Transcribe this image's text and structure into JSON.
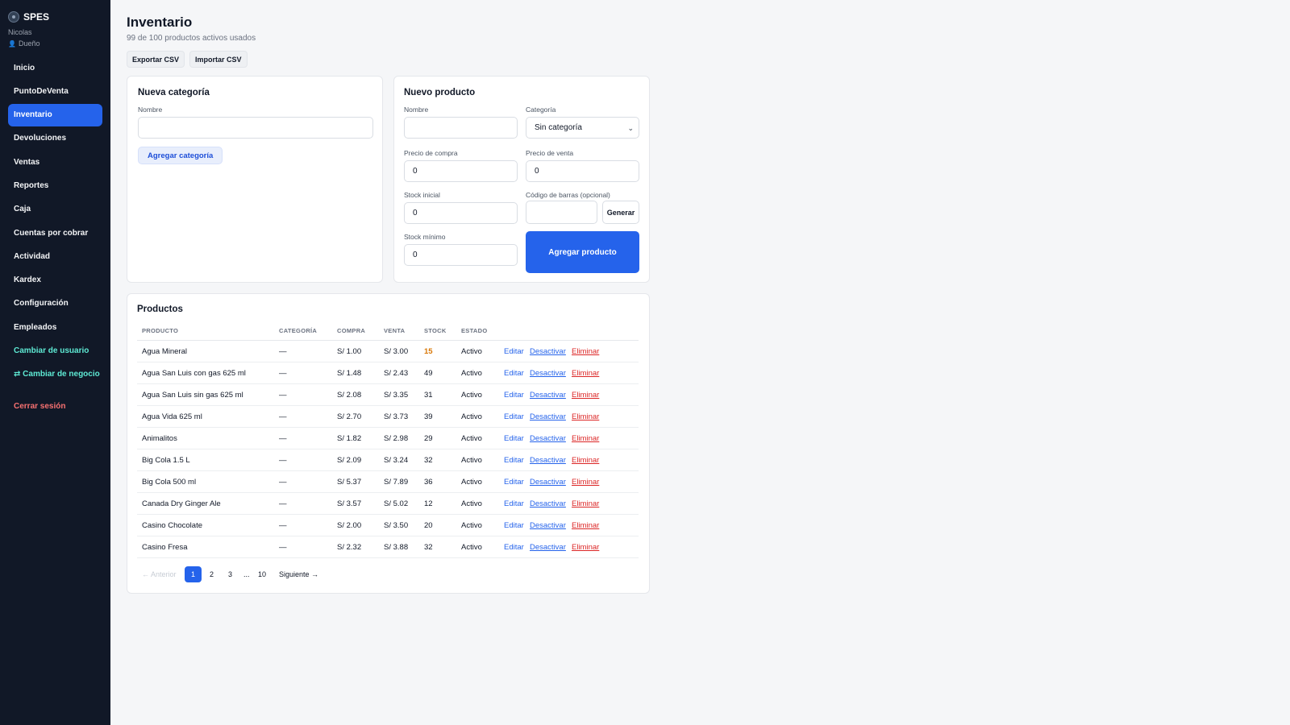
{
  "sidebar": {
    "brand": "SPES",
    "user": "Nicolas",
    "role": "Dueño",
    "items": [
      {
        "label": "Inicio"
      },
      {
        "label": "PuntoDeVenta"
      },
      {
        "label": "Inventario"
      },
      {
        "label": "Devoluciones"
      },
      {
        "label": "Ventas"
      },
      {
        "label": "Reportes"
      },
      {
        "label": "Caja"
      },
      {
        "label": "Cuentas por cobrar"
      },
      {
        "label": "Actividad"
      },
      {
        "label": "Kardex"
      },
      {
        "label": "Configuración"
      },
      {
        "label": "Empleados"
      },
      {
        "label": "Cambiar de usuario"
      },
      {
        "label": "⇄ Cambiar de negocio"
      }
    ],
    "logout": "Cerrar sesión"
  },
  "header": {
    "title": "Inventario",
    "subtitle": "99 de 100 productos activos usados",
    "export_label": "Exportar CSV",
    "import_label": "Importar CSV"
  },
  "category_form": {
    "title": "Nueva categoría",
    "name_label": "Nombre",
    "name_value": "",
    "submit_label": "Agregar categoría"
  },
  "product_form": {
    "title": "Nuevo producto",
    "name_label": "Nombre",
    "name_value": "",
    "category_label": "Categoría",
    "category_value": "Sin categoría",
    "buy_price_label": "Precio de compra",
    "buy_price_value": "0",
    "sell_price_label": "Precio de venta",
    "sell_price_value": "0",
    "stock_label": "Stock inicial",
    "stock_value": "0",
    "barcode_label": "Código de barras (opcional)",
    "barcode_value": "",
    "generate_label": "Generar",
    "min_stock_label": "Stock mínimo",
    "min_stock_value": "0",
    "submit_label": "Agregar producto"
  },
  "products": {
    "title": "Productos",
    "columns": [
      "PRODUCTO",
      "CATEGORÍA",
      "COMPRA",
      "VENTA",
      "STOCK",
      "ESTADO"
    ],
    "rows": [
      {
        "name": "Agua Mineral",
        "category": "—",
        "buy": "S/ 1.00",
        "sell": "S/ 3.00",
        "stock": "15",
        "status": "Activo"
      },
      {
        "name": "Agua San Luis con gas 625 ml",
        "category": "—",
        "buy": "S/ 1.48",
        "sell": "S/ 2.43",
        "stock": "49",
        "status": "Activo"
      },
      {
        "name": "Agua San Luis sin gas 625 ml",
        "category": "—",
        "buy": "S/ 2.08",
        "sell": "S/ 3.35",
        "stock": "31",
        "status": "Activo"
      },
      {
        "name": "Agua Vida 625 ml",
        "category": "—",
        "buy": "S/ 2.70",
        "sell": "S/ 3.73",
        "stock": "39",
        "status": "Activo"
      },
      {
        "name": "Animalitos",
        "category": "—",
        "buy": "S/ 1.82",
        "sell": "S/ 2.98",
        "stock": "29",
        "status": "Activo"
      },
      {
        "name": "Big Cola 1.5 L",
        "category": "—",
        "buy": "S/ 2.09",
        "sell": "S/ 3.24",
        "stock": "32",
        "status": "Activo"
      },
      {
        "name": "Big Cola 500 ml",
        "category": "—",
        "buy": "S/ 5.37",
        "sell": "S/ 7.89",
        "stock": "36",
        "status": "Activo"
      },
      {
        "name": "Canada Dry Ginger Ale",
        "category": "—",
        "buy": "S/ 3.57",
        "sell": "S/ 5.02",
        "stock": "12",
        "status": "Activo"
      },
      {
        "name": "Casino Chocolate",
        "category": "—",
        "buy": "S/ 2.00",
        "sell": "S/ 3.50",
        "stock": "20",
        "status": "Activo"
      },
      {
        "name": "Casino Fresa",
        "category": "—",
        "buy": "S/ 2.32",
        "sell": "S/ 3.88",
        "stock": "32",
        "status": "Activo"
      }
    ],
    "actions": {
      "edit": "Editar",
      "deactivate": "Desactivar",
      "delete": "Eliminar"
    }
  },
  "pagination": {
    "prev": "← Anterior",
    "pages": [
      "1",
      "2",
      "3"
    ],
    "ellipsis": "...",
    "last": "10",
    "next": "Siguiente →"
  },
  "colors": {
    "sidebar_bg": "#111827",
    "accent": "#2563eb",
    "danger": "#dc2626",
    "warning": "#d97706",
    "teal": "#5eead4"
  }
}
